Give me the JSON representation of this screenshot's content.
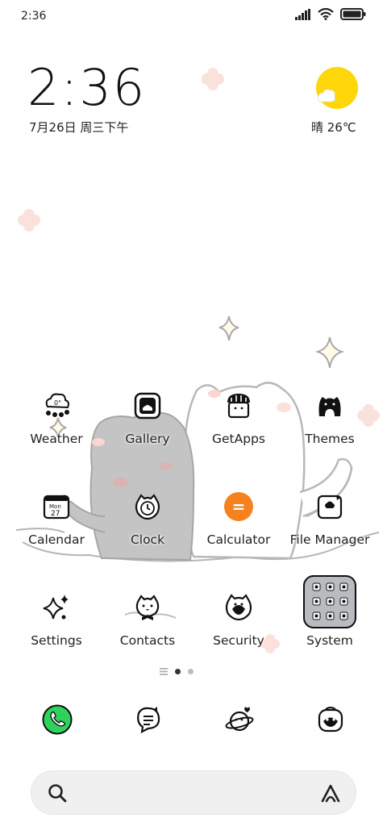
{
  "status_bar": {
    "time": "2:36",
    "icons": [
      "signal-icon",
      "wifi-icon",
      "battery-icon"
    ]
  },
  "clock_widget": {
    "time": "2:36",
    "date": "7月26日 周三下午",
    "weather": "晴 26℃",
    "weather_icon": "sunny-cloud-icon"
  },
  "apps": [
    {
      "label": "Weather",
      "icon": "weather-cloud-icon"
    },
    {
      "label": "Gallery",
      "icon": "gallery-icon"
    },
    {
      "label": "GetApps",
      "icon": "getapps-store-icon"
    },
    {
      "label": "Themes",
      "icon": "themes-cat-icon"
    },
    {
      "label": "Calendar",
      "icon": "calendar-icon"
    },
    {
      "label": "Clock",
      "icon": "clock-icon"
    },
    {
      "label": "Calculator",
      "icon": "calculator-icon"
    },
    {
      "label": "File Manager",
      "icon": "file-manager-icon"
    },
    {
      "label": "Settings",
      "icon": "sparkle-settings-icon"
    },
    {
      "label": "Contacts",
      "icon": "contacts-icon"
    },
    {
      "label": "Security",
      "icon": "security-icon"
    },
    {
      "label": "System",
      "icon": "system-folder-icon"
    }
  ],
  "calendar_icon_text": {
    "month": "Mon",
    "day": "27"
  },
  "calculator_symbol": "=",
  "dock": [
    {
      "icon": "phone-icon"
    },
    {
      "icon": "messages-icon"
    },
    {
      "icon": "browser-planet-icon"
    },
    {
      "icon": "camera-robot-icon"
    }
  ],
  "page_indicator": {
    "pages": 2,
    "current": 1
  },
  "colors": {
    "sun": "#ffd60a",
    "calculator": "#f5821f",
    "phone": "#2fd35c",
    "cat_gray": "#c4c4c4"
  }
}
